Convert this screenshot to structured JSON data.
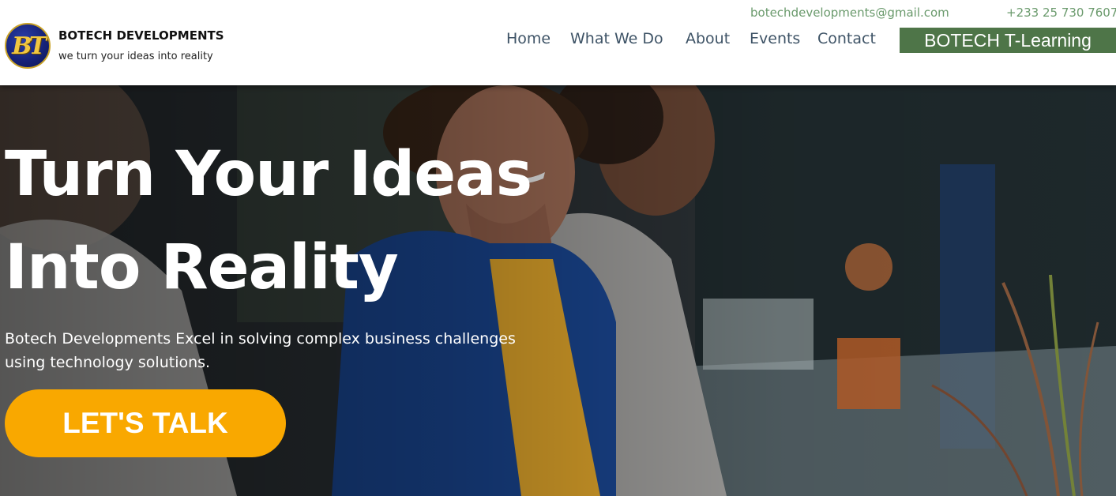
{
  "brand": {
    "logo_text": "BT",
    "name": "BOTECH DEVELOPMENTS",
    "tagline": "we turn your ideas into reality"
  },
  "contact": {
    "email": "botechdevelopments@gmail.com",
    "phone": "+233 25 730 7607"
  },
  "nav": {
    "items": [
      {
        "label": "Home"
      },
      {
        "label": "What We Do"
      },
      {
        "label": "About"
      },
      {
        "label": "Events"
      },
      {
        "label": "Contact"
      }
    ],
    "cta_label": "BOTECH T-Learning"
  },
  "hero": {
    "title_line_1": "Turn Your Ideas",
    "title_line_2": "Into Reality",
    "subtitle_line_1": "Botech Developments Excel in solving complex business challenges",
    "subtitle_line_2": "using technology solutions.",
    "button_label": "LET'S TALK"
  },
  "colors": {
    "nav_text": "#3e5366",
    "contact_text": "#6a9a6c",
    "cta_bg": "#4e7548",
    "button_bg": "#f9a800"
  }
}
